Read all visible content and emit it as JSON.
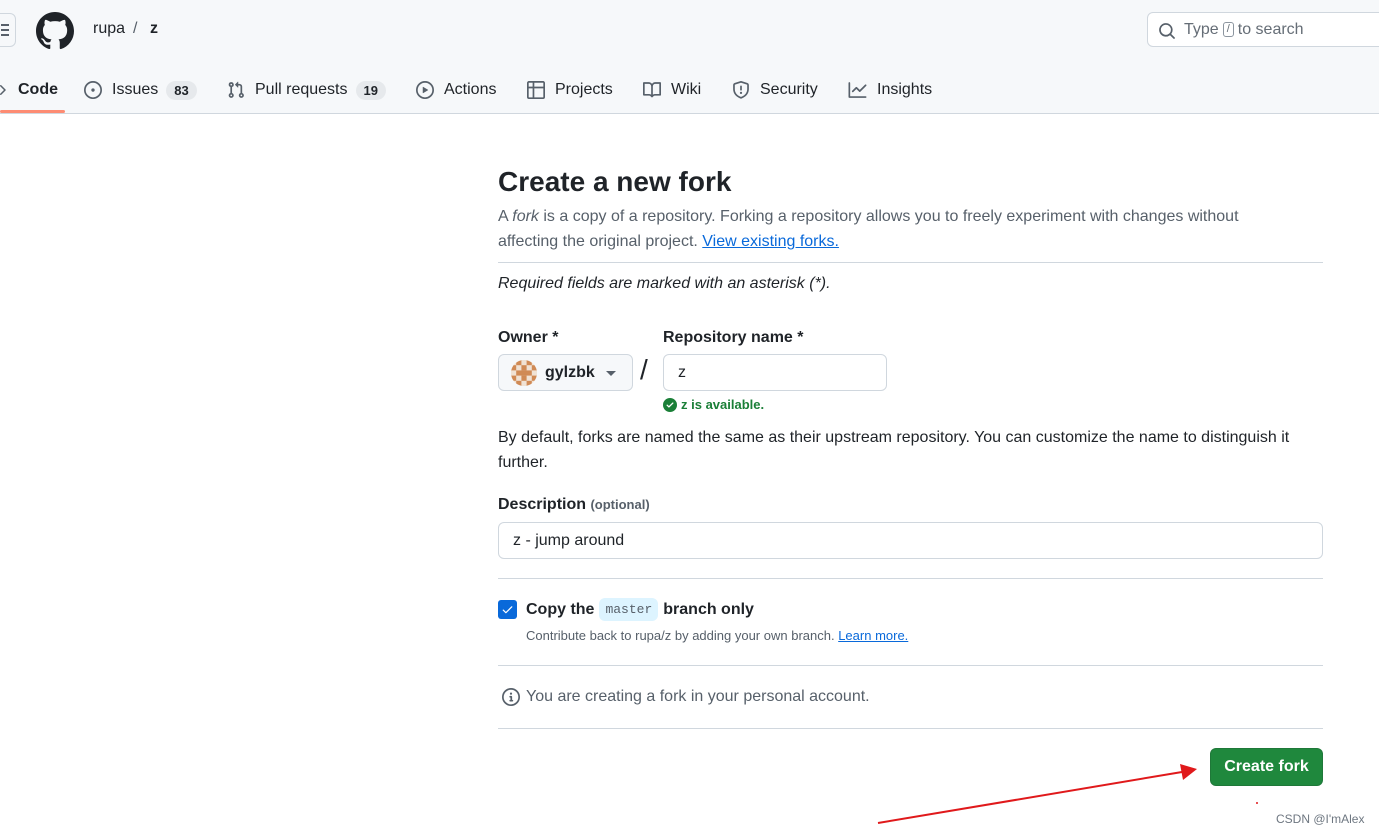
{
  "breadcrumb": {
    "owner": "rupa",
    "separator": "/",
    "repo": "z"
  },
  "search": {
    "placeholder_before": "Type",
    "shortcut_key": "/",
    "placeholder_after": "to search"
  },
  "tabs": [
    {
      "label": "Code",
      "icon": "code-icon",
      "active": true
    },
    {
      "label": "Issues",
      "icon": "issue-opened-icon",
      "count": "83"
    },
    {
      "label": "Pull requests",
      "icon": "git-pull-request-icon",
      "count": "19"
    },
    {
      "label": "Actions",
      "icon": "play-icon"
    },
    {
      "label": "Projects",
      "icon": "table-icon"
    },
    {
      "label": "Wiki",
      "icon": "book-icon"
    },
    {
      "label": "Security",
      "icon": "shield-icon"
    },
    {
      "label": "Insights",
      "icon": "graph-icon"
    }
  ],
  "form": {
    "title": "Create a new fork",
    "intro_a": "A",
    "intro_fork": "fork",
    "intro_b": "is a copy of a repository. Forking a repository allows you to freely experiment with changes without affecting the original project.",
    "view_forks": "View existing forks.",
    "required_note": "Required fields are marked with an asterisk (*).",
    "owner_label": "Owner *",
    "owner_value": "gylzbk",
    "slash": "/",
    "repo_label": "Repository name *",
    "repo_value": "z",
    "available": "z is available.",
    "naming_note": "By default, forks are named the same as their upstream repository. You can customize the name to distinguish it further.",
    "description_label": "Description",
    "description_optional": "(optional)",
    "description_value": "z - jump around",
    "copy_before": "Copy the",
    "copy_branch": "master",
    "copy_after": "branch only",
    "copy_checked": true,
    "copy_note": "Contribute back to rupa/z by adding your own branch.",
    "learn_more": "Learn more.",
    "personal_note": "You are creating a fork in your personal account.",
    "submit": "Create fork"
  },
  "colors": {
    "primary_green": "#1f883d",
    "link_blue": "#0969da",
    "success_green": "#1a7f37",
    "annotation_arrow": "#e0191b"
  },
  "watermark": "CSDN @I'mAlex"
}
